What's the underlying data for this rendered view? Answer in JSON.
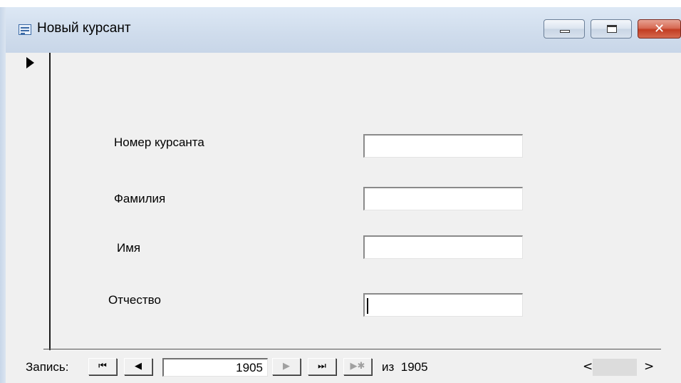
{
  "window": {
    "title": "Новый курсант"
  },
  "form": {
    "fields": [
      {
        "label": "Номер курсанта",
        "value": ""
      },
      {
        "label": "Фамилия",
        "value": ""
      },
      {
        "label": "Имя",
        "value": ""
      },
      {
        "label": "Отчество",
        "value": ""
      }
    ]
  },
  "navigation": {
    "record_label": "Запись:",
    "first_glyph": "⏮",
    "prev_glyph": "◀",
    "current_record": "1905",
    "next_glyph": "▶",
    "last_glyph": "⏭",
    "new_glyph": "▶✱",
    "of_text": "из  1905",
    "scroll_left": "<",
    "scroll_right": ">"
  },
  "icons": {
    "window": "form-icon",
    "minimize": "minimize-icon",
    "maximize": "maximize-icon",
    "close": "close-icon",
    "record_selector": "record-selector-arrow-icon"
  },
  "colors": {
    "close_button": "#c23c22",
    "titlebar": "#cfdcec",
    "body": "#f0f0f0"
  }
}
